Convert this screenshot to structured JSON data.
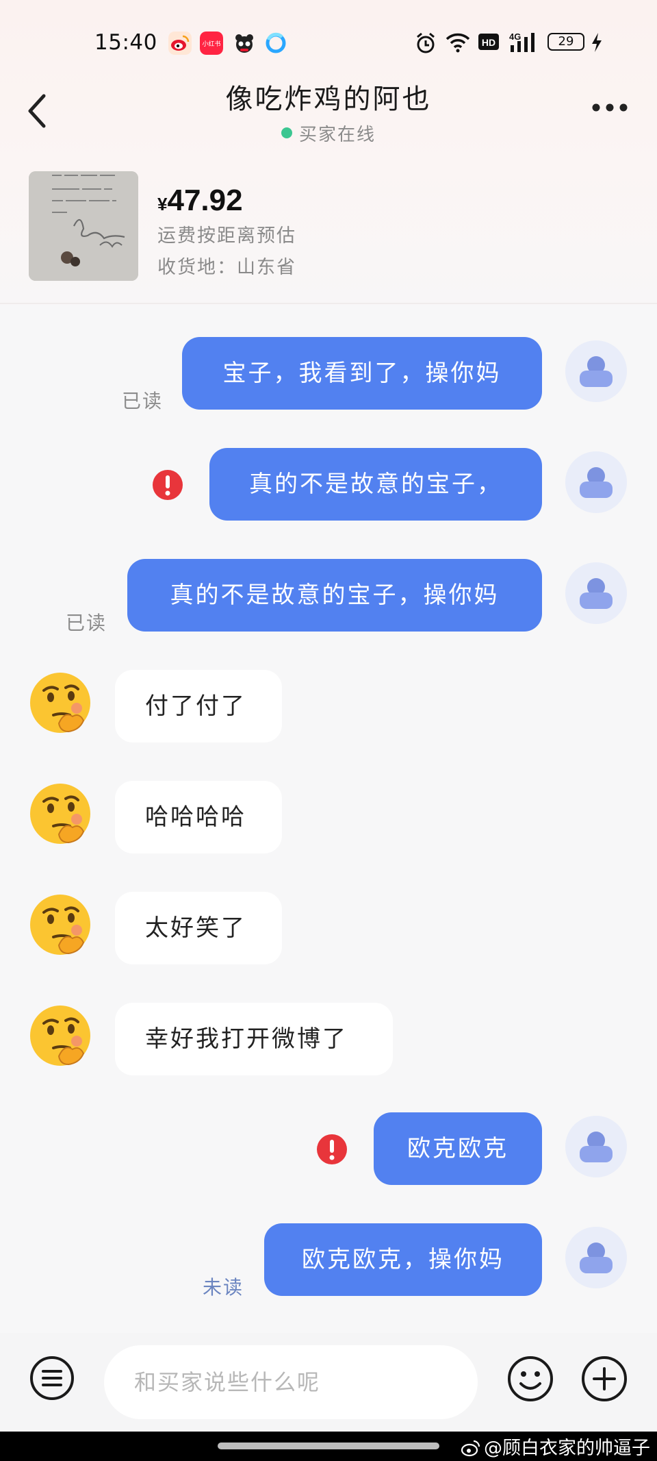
{
  "status_bar": {
    "time": "15:40",
    "app_icons": [
      "weibo-icon",
      "xiaohongshu-icon",
      "panda-app-icon",
      "browser-icon"
    ],
    "xiaohongshu_label": "小红书",
    "right_icons": [
      "alarm-icon",
      "wifi-icon",
      "hd-icon",
      "signal-4g-icon",
      "battery-icon",
      "charging-icon"
    ],
    "hd_label": "HD",
    "network_label": "4G",
    "battery_level": "29"
  },
  "header": {
    "title": "像吃炸鸡的阿也",
    "online_text": "买家在线",
    "online_color": "#3cc691"
  },
  "product": {
    "currency": "¥",
    "price": "47.92",
    "shipping_note": "运费按距离预估",
    "destination": "收货地：山东省"
  },
  "messages": [
    {
      "side": "out",
      "text": "宝子，我看到了，操你妈",
      "status": "已读"
    },
    {
      "side": "out",
      "text": "真的不是故意的宝子，",
      "status": "failed"
    },
    {
      "side": "out",
      "text": "真的不是故意的宝子，操你妈",
      "status": "已读"
    },
    {
      "side": "in",
      "text": "付了付了"
    },
    {
      "side": "in",
      "text": "哈哈哈哈"
    },
    {
      "side": "in",
      "text": "太好笑了"
    },
    {
      "side": "in",
      "text": "幸好我打开微博了"
    },
    {
      "side": "out",
      "text": "欧克欧克",
      "status": "failed"
    },
    {
      "side": "out",
      "text": "欧克欧克，操你妈",
      "status": "未读"
    }
  ],
  "input_bar": {
    "placeholder": "和买家说些什么呢"
  },
  "watermark": {
    "text": "@顾白衣家的帅逼子"
  },
  "colors": {
    "outgoing_bubble": "#5281f0",
    "incoming_bubble": "#ffffff",
    "error": "#e8353b",
    "unread_label": "#6b85c0"
  }
}
